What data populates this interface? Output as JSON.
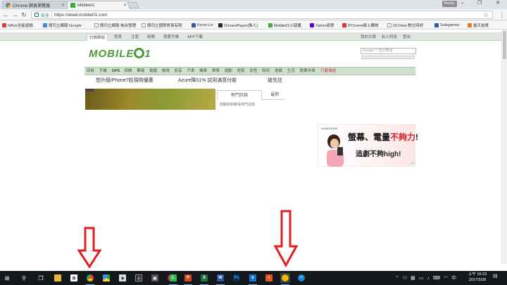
{
  "browser": {
    "tabs": [
      {
        "title": "Chrome 網頁瀏覽器",
        "active": false,
        "favicon": "google-icon"
      },
      {
        "title": "Mobile01",
        "active": true,
        "favicon": "mobile01-icon"
      }
    ],
    "profile": "Bwyby",
    "address": {
      "secure_label": "安全",
      "url": "https://www.mobile01.com"
    },
    "bookmarks": [
      {
        "label": "hiBox全能遊戲",
        "icon": "tv-icon",
        "color": "#e03b3b"
      },
      {
        "label": "簡司立網路 Google",
        "icon": "google-icon",
        "color": "#4285f4"
      },
      {
        "label": "簡司立網路 後台管理",
        "icon": "page-icon",
        "color": "#999999"
      },
      {
        "label": "簡司立國際貿易有限",
        "icon": "page-icon",
        "color": "#999999"
      },
      {
        "label": "Kevin Lin",
        "icon": "facebook-icon",
        "color": "#3b5998"
      },
      {
        "label": "DronesPlayer(無人)",
        "icon": "x-icon",
        "color": "#2a2a2a"
      },
      {
        "label": "Mobile01小惡魔",
        "icon": "mobile01-icon",
        "color": "#3bab3b"
      },
      {
        "label": "Yahoo奇摩",
        "icon": "yahoo-icon",
        "color": "#6001d2"
      },
      {
        "label": "PChome線上購物",
        "icon": "pchome-icon",
        "color": "#e53030"
      },
      {
        "label": "DCView 數位時評",
        "icon": "page-icon",
        "color": "#999999"
      },
      {
        "label": "Salegamez",
        "icon": "s-icon",
        "color": "#3355aa"
      },
      {
        "label": "露天拍賣",
        "icon": "ruten-icon",
        "color": "#f07a1a"
      }
    ]
  },
  "site": {
    "topnav": {
      "items": [
        "討論群組",
        "發表",
        "注意",
        "新聞",
        "我愛手機",
        "APP下載"
      ],
      "right": [
        "我的文章",
        "私人訊息",
        "登出"
      ]
    },
    "logo_text": "MOBILE",
    "logo_suffix": "1",
    "search_placeholder": "Google™ 自訂搜尋",
    "categories": [
      "回收",
      "手機",
      "GPS",
      "相機",
      "筆電",
      "電腦",
      "電視",
      "影音",
      "汽車",
      "機車",
      "單車",
      "運動",
      "居家",
      "女性",
      "時尚",
      "遊戲",
      "生活",
      "股票市場",
      "行動電話"
    ],
    "promos": [
      "想升級iPhone?趁現時優惠",
      "Azure降51% 試用滿意付款",
      "搶先註"
    ],
    "hot_tabs": [
      "熱門討論",
      "最新"
    ],
    "hot_note": "閒聊和新鮮事熱門話題"
  },
  "ad": {
    "brand": "SAMSUNG",
    "line1_prefix": "螢幕、電量",
    "line1_red": "不夠力",
    "line1_suffix": "!",
    "line2": "追劇不夠high!",
    "mark": "▷×"
  },
  "taskbar": {
    "apps": [
      {
        "name": "windows-icon"
      },
      {
        "name": "search-icon"
      },
      {
        "name": "task-view-icon"
      },
      {
        "name": "file-explorer-icon"
      },
      {
        "name": "store-icon"
      },
      {
        "name": "chrome-icon"
      },
      {
        "name": "drive-icon"
      },
      {
        "name": "onedrive-icon"
      },
      {
        "name": "alienware-icon"
      },
      {
        "name": "camera-icon"
      },
      {
        "name": "weibo-icon"
      },
      {
        "name": "line-icon"
      },
      {
        "name": "powerpoint-icon"
      },
      {
        "name": "excel-icon"
      },
      {
        "name": "word-icon"
      },
      {
        "name": "photoshop-icon"
      },
      {
        "name": "photoshop2-icon"
      },
      {
        "name": "edge-icon"
      },
      {
        "name": "media-icon"
      },
      {
        "name": "chrome-canary-icon"
      },
      {
        "name": "bluewave-icon"
      }
    ],
    "clock_time": "上午 10:23",
    "clock_date": "2017/3/28"
  }
}
